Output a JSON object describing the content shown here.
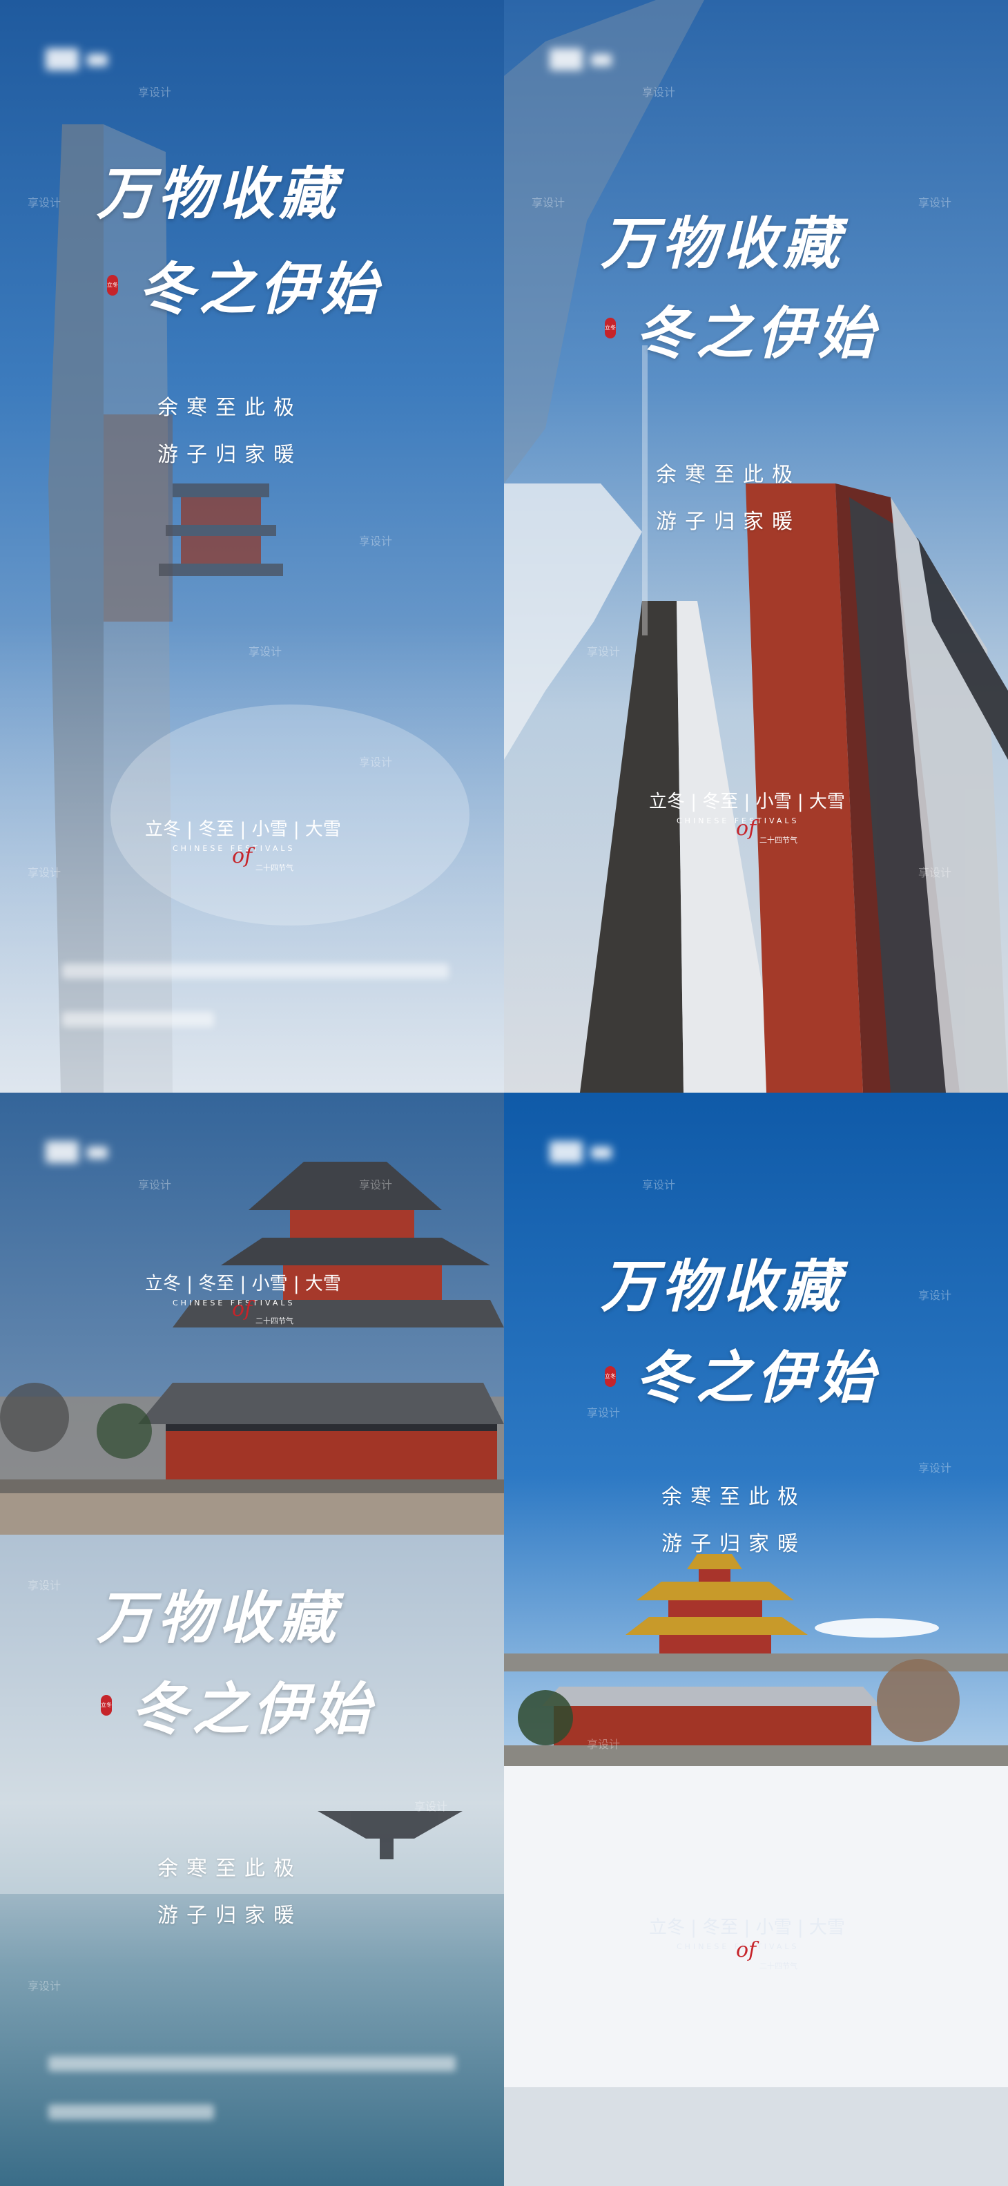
{
  "posters": [
    {
      "title_line1": "万物收藏",
      "title_line2": "冬之伊始",
      "seal_text": "立冬",
      "sub_line1": "余寒至此极",
      "sub_line2": "游子归家暖",
      "festivals": "立冬 | 冬至 | 小雪 | 大雪",
      "festivals_en": "CHINESE FESTIVALS",
      "festivals_cn": "二十四节气",
      "of_text": "of"
    },
    {
      "title_line1": "万物收藏",
      "title_line2": "冬之伊始",
      "seal_text": "立冬",
      "sub_line1": "余寒至此极",
      "sub_line2": "游子归家暖",
      "festivals": "立冬 | 冬至 | 小雪 | 大雪",
      "festivals_en": "CHINESE FESTIVALS",
      "festivals_cn": "二十四节气",
      "of_text": "of"
    },
    {
      "title_line1": "万物收藏",
      "title_line2": "冬之伊始",
      "seal_text": "立冬",
      "sub_line1": "余寒至此极",
      "sub_line2": "游子归家暖",
      "festivals": "立冬 | 冬至 | 小雪 | 大雪",
      "festivals_en": "CHINESE FESTIVALS",
      "festivals_cn": "二十四节气",
      "of_text": "of"
    },
    {
      "title_line1": "万物收藏",
      "title_line2": "冬之伊始",
      "seal_text": "立冬",
      "sub_line1": "余寒至此极",
      "sub_line2": "游子归家暖",
      "festivals": "立冬 | 冬至 | 小雪 | 大雪",
      "festivals_en": "CHINESE FESTIVALS",
      "festivals_cn": "二十四节气",
      "of_text": "of"
    }
  ],
  "watermark": "享设计",
  "colors": {
    "seal_red": "#c6242a",
    "wall_red": "#b3372a",
    "roof_dark": "#3a3f46"
  },
  "icons": {
    "logo": "blurred-brand-logo"
  }
}
